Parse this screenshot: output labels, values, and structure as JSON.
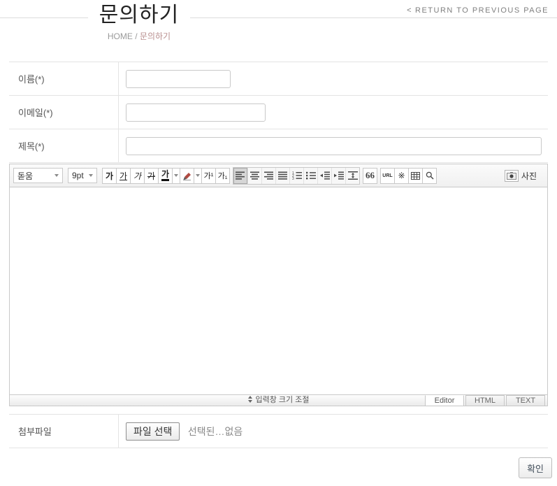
{
  "header": {
    "return_chevron": "<",
    "return_label": "RETURN TO PREVIOUS PAGE",
    "title": "문의하기",
    "breadcrumb": {
      "home": "HOME",
      "separator": "/",
      "current": "문의하기"
    }
  },
  "form": {
    "rows": [
      {
        "label": "이름(*)",
        "value": ""
      },
      {
        "label": "이메일(*)",
        "value": ""
      },
      {
        "label": "제목(*)",
        "value": ""
      }
    ]
  },
  "editor": {
    "toolbar": {
      "font_family": "돋움",
      "font_size": "9pt",
      "bold": "가",
      "underline": "가",
      "italic": "가",
      "strikethrough": "가",
      "font_color": "가",
      "superscript": "가¹",
      "subscript": "가₁",
      "quote": "66",
      "url": "URL",
      "special_char": "※",
      "photo": "사진"
    },
    "content": "",
    "resize_label": "입력창 크기 조절",
    "tabs": [
      {
        "label": "Editor",
        "active": true
      },
      {
        "label": "HTML",
        "active": false
      },
      {
        "label": "TEXT",
        "active": false
      }
    ]
  },
  "attachment": {
    "label": "첨부파일",
    "button_label": "파일 선택",
    "status": "선택된…없음"
  },
  "actions": {
    "confirm_label": "확인"
  },
  "colors": {
    "breadcrumb_accent": "#b98f8f",
    "row_border": "#e4e4e4",
    "editor_border": "#c9c9c9",
    "muted_text": "#8a8a8a"
  }
}
